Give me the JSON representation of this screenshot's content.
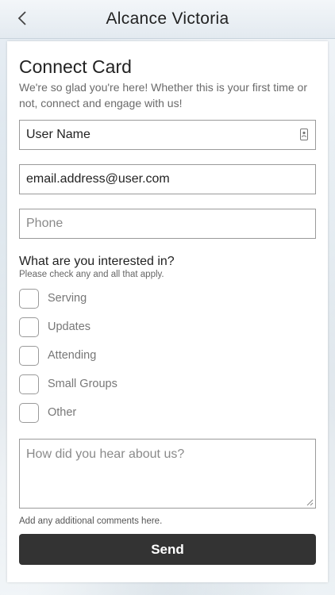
{
  "navbar": {
    "title": "Alcance Victoria",
    "back_icon": "chevron-left-icon"
  },
  "form": {
    "title": "Connect Card",
    "subtitle": "We're so glad you're here! Whether this is your first time or not, connect and engage with us!",
    "fields": {
      "username": {
        "value": "User Name",
        "icon": "contact-card-icon"
      },
      "email": {
        "value": "email.address@user.com"
      },
      "phone": {
        "placeholder": "Phone"
      }
    },
    "interests": {
      "title": "What are you interested in?",
      "subtitle": "Please check any and all that apply.",
      "options": [
        {
          "label": "Serving",
          "checked": false
        },
        {
          "label": "Updates",
          "checked": false
        },
        {
          "label": "Attending",
          "checked": false
        },
        {
          "label": "Small Groups",
          "checked": false
        },
        {
          "label": "Other",
          "checked": false
        }
      ]
    },
    "comments": {
      "placeholder": "How did you hear about us?",
      "helper": "Add any additional comments here."
    },
    "send_label": "Send"
  },
  "colors": {
    "button_bg": "#333333",
    "border": "#9a9a9a"
  }
}
